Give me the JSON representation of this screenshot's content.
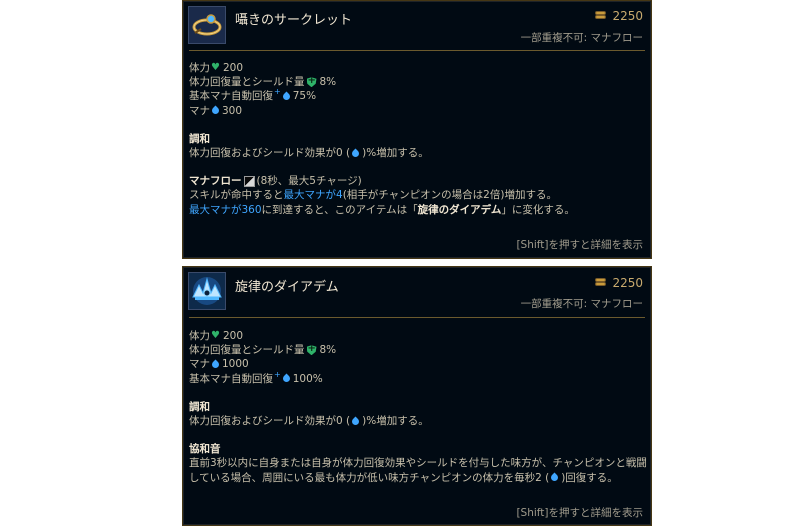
{
  "items": [
    {
      "name": "囁きのサークレット",
      "price": "2250",
      "stack_note": "一部重複不可: マナフロー",
      "stats": [
        {
          "label": "体力",
          "icon": "heart-icon",
          "value": "200"
        },
        {
          "label": "体力回復量とシールド量",
          "icon": "shield-icon",
          "value": "8%"
        },
        {
          "label": "基本マナ自動回復",
          "icon": "mana-regen-drop-icon",
          "value": "75%"
        },
        {
          "label": "マナ",
          "icon": "mana-drop-icon",
          "value": "300"
        }
      ],
      "passive1": {
        "title": "調和",
        "text_a": "体力回復およびシールド効果が0 (",
        "text_b": ")%増加する。"
      },
      "passive2": {
        "title": "マナフロー",
        "cooldown": "(8秒、最大5チャージ)",
        "line1_a": "スキルが命中すると",
        "line1_hl": "最大マナが4",
        "line1_b": "(相手がチャンピオンの場合は2倍)増加する。",
        "line2_hl": "最大マナが360",
        "line2_a": "に到達すると、このアイテムは「",
        "line2_bold": "旋律のダイアデム",
        "line2_b": "」に変化する。"
      },
      "footer": "[Shift]を押すと詳細を表示"
    },
    {
      "name": "旋律のダイアデム",
      "price": "2250",
      "stack_note": "一部重複不可: マナフロー",
      "stats": [
        {
          "label": "体力",
          "icon": "heart-icon",
          "value": "200"
        },
        {
          "label": "体力回復量とシールド量",
          "icon": "shield-icon",
          "value": "8%"
        },
        {
          "label": "マナ",
          "icon": "mana-drop-icon",
          "value": "1000"
        },
        {
          "label": "基本マナ自動回復",
          "icon": "mana-regen-drop-icon",
          "value": "100%"
        }
      ],
      "passive1": {
        "title": "調和",
        "text_a": "体力回復およびシールド効果が0 (",
        "text_b": ")%増加する。"
      },
      "passive2": {
        "title": "協和音",
        "line1": "直前3秒以内に自身または自身が体力回復効果やシールドを付与した味方が、チャンピオンと戦闘",
        "line2_a": "している場合、周囲にいる最も体力が低い味方チャンピオンの体力を毎秒2 (",
        "line2_b": ")回復する。"
      },
      "footer": "[Shift]を押すと詳細を表示"
    }
  ],
  "colors": {
    "background": "#010a13",
    "border": "#463714",
    "gold": "#c8aa6e",
    "text": "#c8c0ab",
    "highlight": "#3fa6ff",
    "health_green": "#2fb36a"
  }
}
